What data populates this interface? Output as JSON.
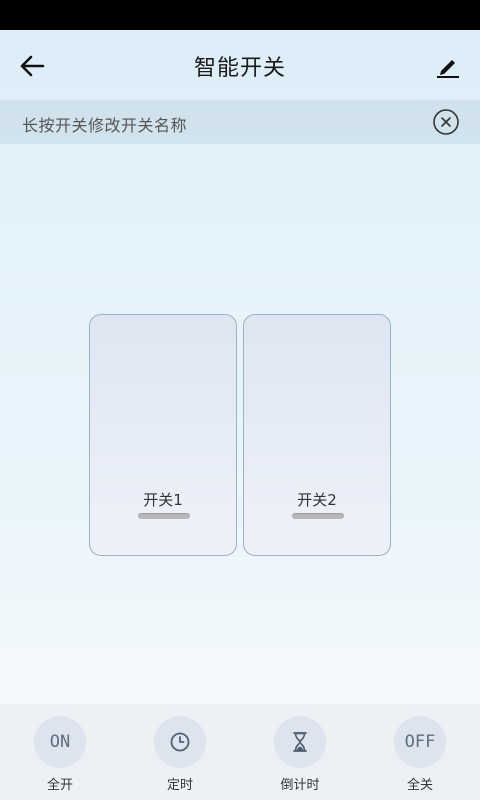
{
  "header": {
    "title": "智能开关"
  },
  "tip": {
    "text": "长按开关修改开关名称"
  },
  "switches": [
    {
      "label": "开关1"
    },
    {
      "label": "开关2"
    }
  ],
  "actions": [
    {
      "icon_text": "ON",
      "label": "全开"
    },
    {
      "icon": "clock-icon",
      "label": "定时"
    },
    {
      "icon": "hourglass-icon",
      "label": "倒计时"
    },
    {
      "icon_text": "OFF",
      "label": "全关"
    }
  ],
  "colors": {
    "status_bar": "#000000",
    "icon_gray": "#5c6f82",
    "key_border": "#9fb0c4"
  }
}
